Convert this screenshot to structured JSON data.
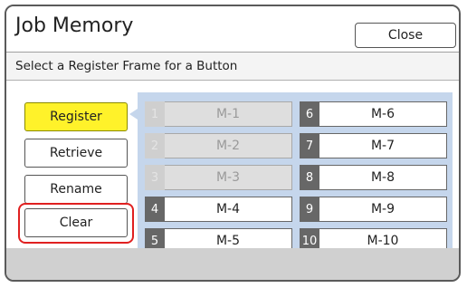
{
  "title": "Job Memory",
  "close_label": "Close",
  "subtitle": "Select a Register Frame for a Button",
  "actions": [
    {
      "label": "Register",
      "selected": true
    },
    {
      "label": "Retrieve",
      "selected": false
    },
    {
      "label": "Rename",
      "selected": false
    },
    {
      "label": "Clear",
      "selected": false,
      "highlighted": true
    }
  ],
  "slots": [
    {
      "num": "1",
      "name": "M-1",
      "enabled": false
    },
    {
      "num": "2",
      "name": "M-2",
      "enabled": false
    },
    {
      "num": "3",
      "name": "M-3",
      "enabled": false
    },
    {
      "num": "4",
      "name": "M-4",
      "enabled": true
    },
    {
      "num": "5",
      "name": "M-5",
      "enabled": true
    },
    {
      "num": "6",
      "name": "M-6",
      "enabled": true
    },
    {
      "num": "7",
      "name": "M-7",
      "enabled": true
    },
    {
      "num": "8",
      "name": "M-8",
      "enabled": true
    },
    {
      "num": "9",
      "name": "M-9",
      "enabled": true
    },
    {
      "num": "10",
      "name": "M-10",
      "enabled": true
    }
  ],
  "colors": {
    "selected_button": "#fff22a",
    "highlight_ring": "#e02020",
    "slot_panel": "#c5d6ec",
    "slot_number_bg": "#676767"
  }
}
